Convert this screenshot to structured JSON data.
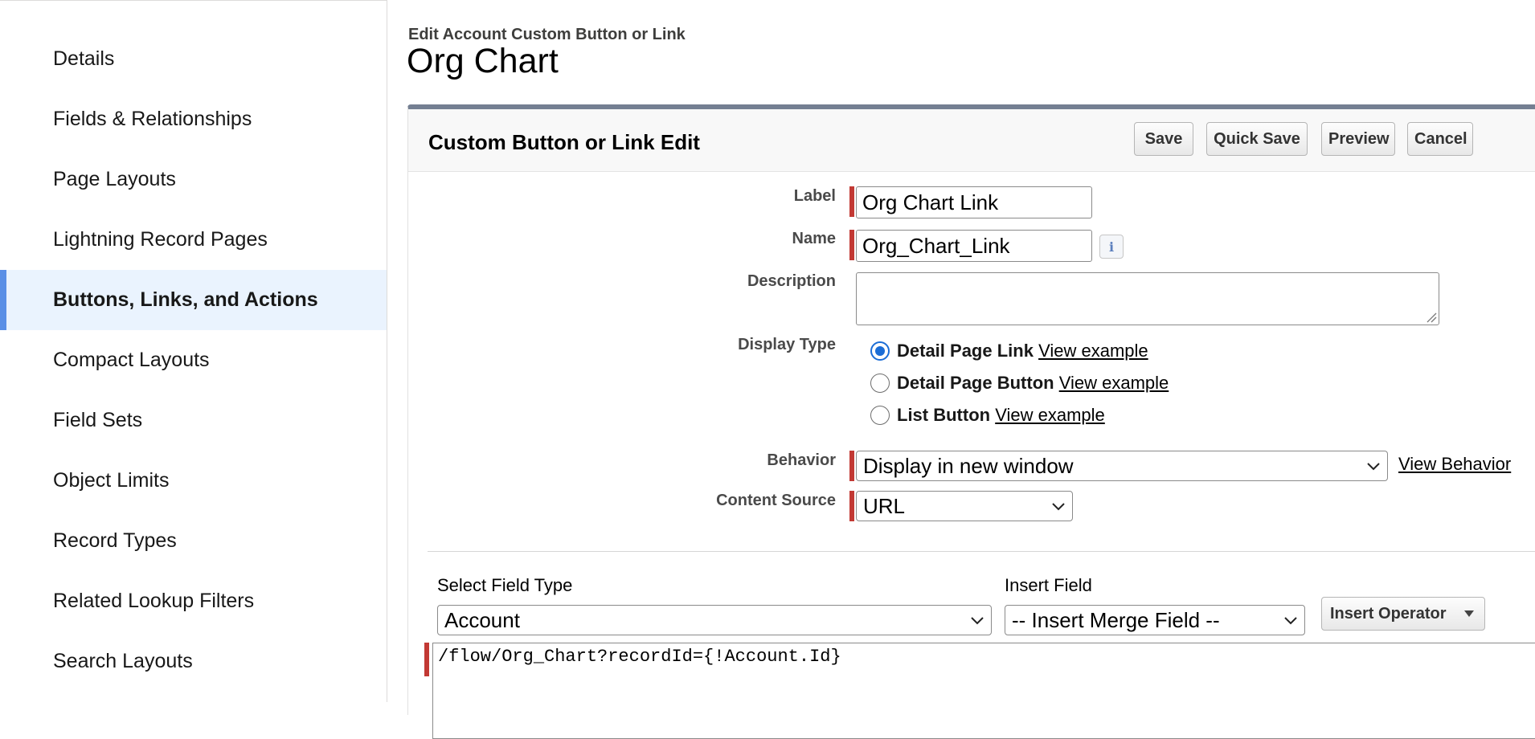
{
  "sidebar": {
    "items": [
      {
        "label": "Details",
        "active": false
      },
      {
        "label": "Fields & Relationships",
        "active": false
      },
      {
        "label": "Page Layouts",
        "active": false
      },
      {
        "label": "Lightning Record Pages",
        "active": false
      },
      {
        "label": "Buttons, Links, and Actions",
        "active": true
      },
      {
        "label": "Compact Layouts",
        "active": false
      },
      {
        "label": "Field Sets",
        "active": false
      },
      {
        "label": "Object Limits",
        "active": false
      },
      {
        "label": "Record Types",
        "active": false
      },
      {
        "label": "Related Lookup Filters",
        "active": false
      },
      {
        "label": "Search Layouts",
        "active": false
      }
    ],
    "active_accent": "#5a8fe6"
  },
  "header": {
    "breadcrumb": "Edit Account Custom Button or Link",
    "title": "Org Chart"
  },
  "panel": {
    "title": "Custom Button or Link Edit",
    "buttons": {
      "save": "Save",
      "quick_save": "Quick Save",
      "preview": "Preview",
      "cancel": "Cancel"
    }
  },
  "form": {
    "label_label": "Label",
    "label_value": "Org Chart Link",
    "name_label": "Name",
    "name_value": "Org_Chart_Link",
    "description_label": "Description",
    "description_value": "",
    "display_type_label": "Display Type",
    "display_types": [
      {
        "label": "Detail Page Link",
        "link": "View example",
        "checked": true
      },
      {
        "label": "Detail Page Button",
        "link": "View example",
        "checked": false
      },
      {
        "label": "List Button",
        "link": "View example",
        "checked": false
      }
    ],
    "behavior_label": "Behavior",
    "behavior_value": "Display in new window",
    "behavior_link": "View Behavior",
    "content_source_label": "Content Source",
    "content_source_value": "URL",
    "required_color": "#c23934"
  },
  "formula": {
    "select_field_type_label": "Select Field Type",
    "select_field_type_value": "Account",
    "insert_field_label": "Insert Field",
    "insert_field_value": "-- Insert Merge Field --",
    "insert_operator": "Insert Operator",
    "content": "/flow/Org_Chart?recordId={!Account.Id}"
  },
  "icons": {
    "info": "info-icon",
    "chevron": "chevron-down-icon",
    "caret": "caret-down-icon"
  }
}
